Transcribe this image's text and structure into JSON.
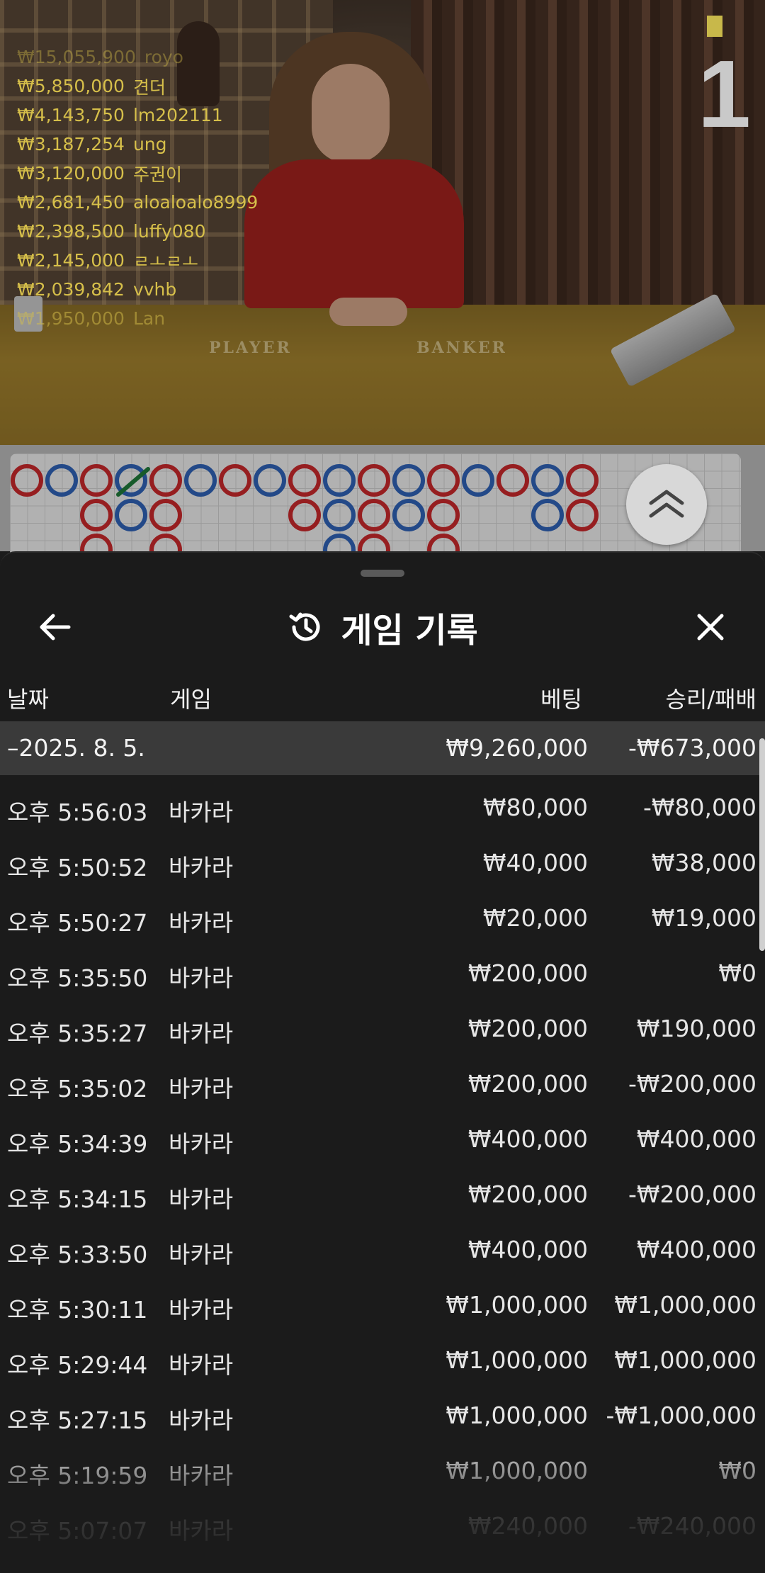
{
  "video": {
    "round_number": "1",
    "table_labels": {
      "player": "PLAYER",
      "banker": "BANKER"
    },
    "winners": [
      {
        "amount": "₩15,055,900",
        "name": "royo"
      },
      {
        "amount": "₩5,850,000",
        "name": "견더"
      },
      {
        "amount": "₩4,143,750",
        "name": "lm202111"
      },
      {
        "amount": "₩3,187,254",
        "name": "ung"
      },
      {
        "amount": "₩3,120,000",
        "name": "주권이"
      },
      {
        "amount": "₩2,681,450",
        "name": "aloaloalo8999"
      },
      {
        "amount": "₩2,398,500",
        "name": "luffy080"
      },
      {
        "amount": "₩2,145,000",
        "name": "ㄹㅗㄹㅗ"
      },
      {
        "amount": "₩2,039,842",
        "name": "vvhb"
      },
      {
        "amount": "₩1,950,000",
        "name": "Lan"
      }
    ]
  },
  "roadmap": {
    "colors": {
      "red": "#c8282b",
      "blue": "#2f62b6",
      "check": "#1f7a3a"
    },
    "columns": [
      [
        "R"
      ],
      [
        "B"
      ],
      [
        "R",
        "R",
        "R"
      ],
      [
        "B",
        "B"
      ],
      [
        "R",
        "R",
        "R"
      ],
      [
        "B"
      ],
      [
        "R"
      ],
      [
        "B"
      ],
      [
        "R",
        "R"
      ],
      [
        "B",
        "B",
        "B"
      ],
      [
        "R",
        "R",
        "R"
      ],
      [
        "B",
        "B"
      ],
      [
        "R",
        "R",
        "R"
      ],
      [
        "B"
      ],
      [
        "R"
      ],
      [
        "B",
        "B"
      ],
      [
        "R",
        "R"
      ]
    ]
  },
  "sheet": {
    "title": "게임 기록",
    "icons": {
      "back": "arrow-left-icon",
      "history": "history-icon",
      "close": "close-icon",
      "expand": "chevron-double-up-icon"
    },
    "columns": {
      "date": "날짜",
      "game": "게임",
      "bet": "베팅",
      "winloss": "승리/패배"
    },
    "date_group": {
      "date": "–2025. 8. 5.",
      "bet_total": "₩9,260,000",
      "winloss_total": "-₩673,000"
    },
    "rows": [
      {
        "time": "오후 5:56:03",
        "game": "바카라",
        "bet": "₩80,000",
        "winloss": "-₩80,000"
      },
      {
        "time": "오후 5:50:52",
        "game": "바카라",
        "bet": "₩40,000",
        "winloss": "₩38,000"
      },
      {
        "time": "오후 5:50:27",
        "game": "바카라",
        "bet": "₩20,000",
        "winloss": "₩19,000"
      },
      {
        "time": "오후 5:35:50",
        "game": "바카라",
        "bet": "₩200,000",
        "winloss": "₩0"
      },
      {
        "time": "오후 5:35:27",
        "game": "바카라",
        "bet": "₩200,000",
        "winloss": "₩190,000"
      },
      {
        "time": "오후 5:35:02",
        "game": "바카라",
        "bet": "₩200,000",
        "winloss": "-₩200,000"
      },
      {
        "time": "오후 5:34:39",
        "game": "바카라",
        "bet": "₩400,000",
        "winloss": "₩400,000"
      },
      {
        "time": "오후 5:34:15",
        "game": "바카라",
        "bet": "₩200,000",
        "winloss": "-₩200,000"
      },
      {
        "time": "오후 5:33:50",
        "game": "바카라",
        "bet": "₩400,000",
        "winloss": "₩400,000"
      },
      {
        "time": "오후 5:30:11",
        "game": "바카라",
        "bet": "₩1,000,000",
        "winloss": "₩1,000,000"
      },
      {
        "time": "오후 5:29:44",
        "game": "바카라",
        "bet": "₩1,000,000",
        "winloss": "₩1,000,000"
      },
      {
        "time": "오후 5:27:15",
        "game": "바카라",
        "bet": "₩1,000,000",
        "winloss": "-₩1,000,000"
      },
      {
        "time": "오후 5:19:59",
        "game": "바카라",
        "bet": "₩1,000,000",
        "winloss": "₩0"
      },
      {
        "time": "오후 5:07:07",
        "game": "바카라",
        "bet": "₩240,000",
        "winloss": "-₩240,000"
      }
    ]
  }
}
